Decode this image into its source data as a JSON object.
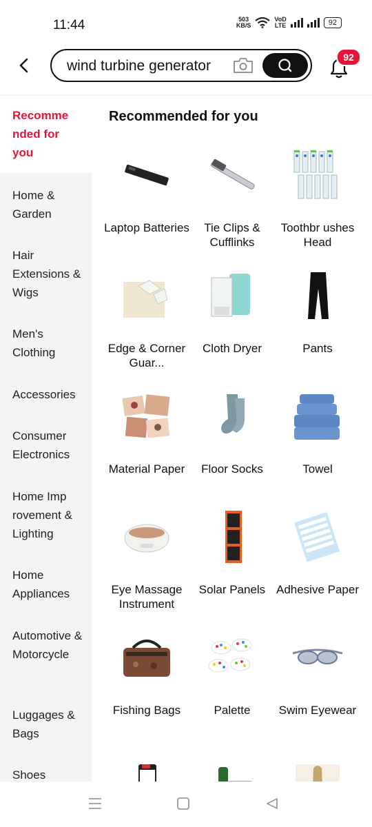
{
  "status_bar": {
    "time": "11:44",
    "net_speed_value": "503",
    "net_speed_unit": "KB/S",
    "network_label_top": "VoD",
    "network_label_bottom": "LTE",
    "battery": "92"
  },
  "header": {
    "search_query": "wind turbine generator",
    "notification_count": "92"
  },
  "sidebar": {
    "active": "Recomme nded for you",
    "items": [
      "Home & Garden",
      "Hair Extensions & Wigs",
      "Men's Clothing",
      "Accessories",
      "Consumer Electronics",
      "Home Imp rovement & Lighting",
      "Home Appliances",
      "Automotive & Motorcycle",
      "Luggages & Bags",
      "Shoes"
    ]
  },
  "main": {
    "title": "Recommended for you",
    "categories": [
      {
        "label": "Laptop Batteries",
        "icon": "laptop-battery-image"
      },
      {
        "label": "Tie Clips & Cufflinks",
        "icon": "tie-clip-image"
      },
      {
        "label": "Toothbr ushes Head",
        "icon": "toothbrush-heads-image"
      },
      {
        "label": "Edge & Corner Guar...",
        "icon": "corner-guard-image"
      },
      {
        "label": "Cloth Dryer",
        "icon": "cloth-dryer-image"
      },
      {
        "label": "Pants",
        "icon": "pants-image"
      },
      {
        "label": "Material Paper",
        "icon": "material-paper-image"
      },
      {
        "label": "Floor Socks",
        "icon": "floor-socks-image"
      },
      {
        "label": "Towel",
        "icon": "towel-image"
      },
      {
        "label": "Eye Massage Instrument",
        "icon": "eye-massager-image"
      },
      {
        "label": "Solar Panels",
        "icon": "solar-panel-image"
      },
      {
        "label": "Adhesive Paper",
        "icon": "adhesive-paper-image"
      },
      {
        "label": "Fishing Bags",
        "icon": "fishing-bag-image"
      },
      {
        "label": "Palette",
        "icon": "palette-image"
      },
      {
        "label": "Swim Eyewear",
        "icon": "swim-goggles-image"
      },
      {
        "label": "",
        "icon": "product-image"
      },
      {
        "label": "",
        "icon": "product-image"
      },
      {
        "label": "",
        "icon": "product-image"
      }
    ]
  },
  "colors": {
    "accent": "#e4153b",
    "sidebar_bg": "#f4f4f4"
  }
}
